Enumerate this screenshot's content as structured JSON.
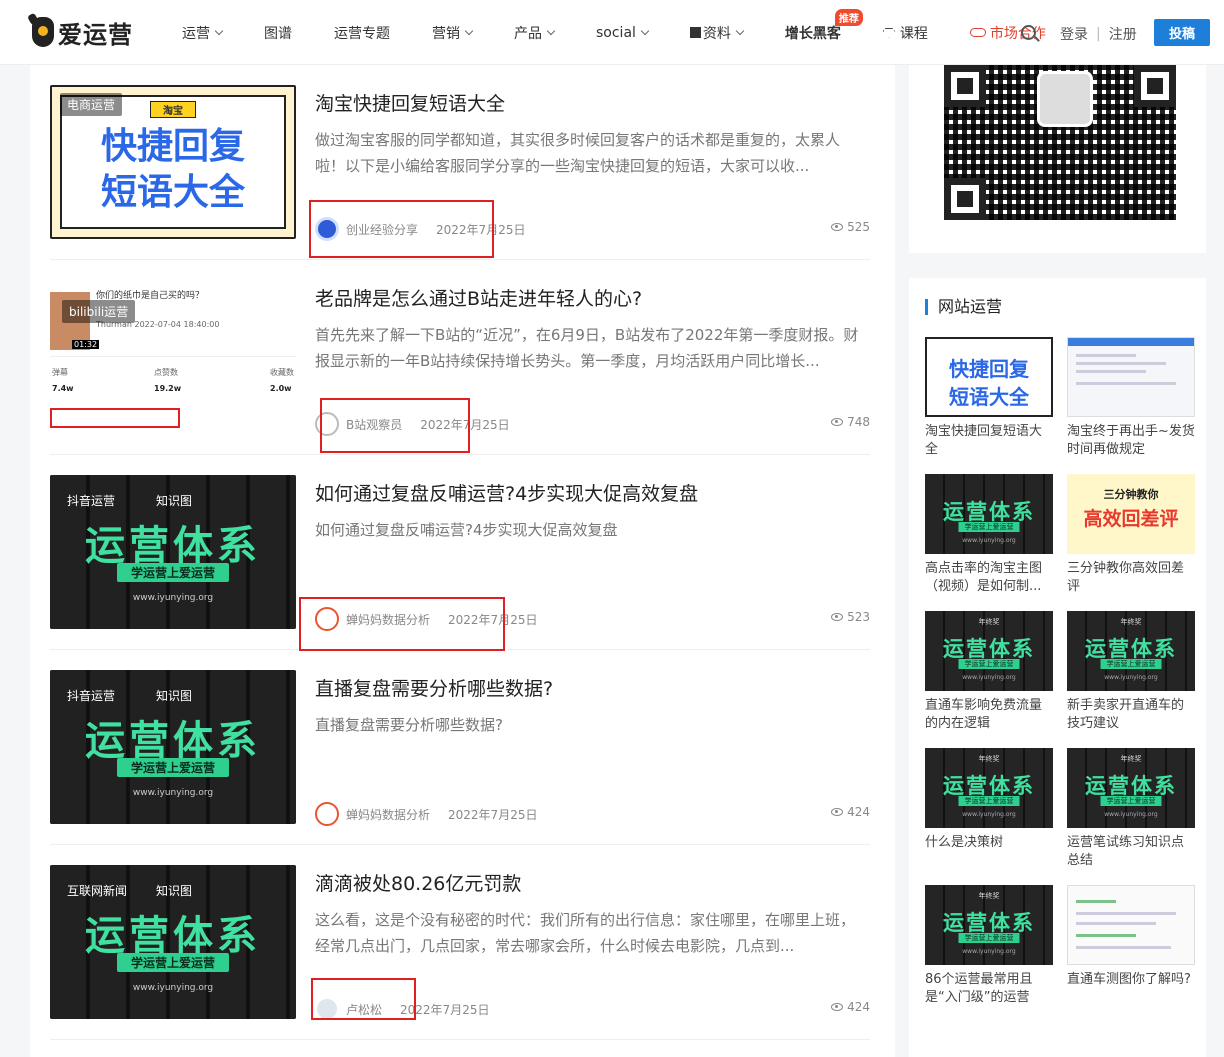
{
  "header": {
    "logo_text": "爱运营",
    "nav": [
      {
        "label": "运营",
        "dropdown": true
      },
      {
        "label": "图谱",
        "dropdown": false
      },
      {
        "label": "运营专题",
        "dropdown": false
      },
      {
        "label": "营销",
        "dropdown": true
      },
      {
        "label": "产品",
        "dropdown": true
      },
      {
        "label": "social",
        "dropdown": true
      },
      {
        "label": "资料",
        "dropdown": true
      },
      {
        "label": "增长黑客",
        "badge": "推荐"
      },
      {
        "label": "课程"
      },
      {
        "label": "市场合作"
      }
    ],
    "login": "登录",
    "register": "注册",
    "post_button": "投稿"
  },
  "articles": [
    {
      "title": "淘宝快捷回复短语大全",
      "excerpt": "做过淘宝客服的同学都知道，其实很多时候回复客户的话术都是重复的，太累人啦！以下是小编给客服同学分享的一些淘宝快捷回复的短语，大家可以收...",
      "author": "创业经验分享",
      "date": "2022年7月25日",
      "views": "525",
      "tag": "电商运营",
      "thumb_pill": "淘宝",
      "thumb_line1": "快捷回复",
      "thumb_line2": "短语大全"
    },
    {
      "title": "老品牌是怎么通过B站走进年轻人的心?",
      "excerpt": "首先先来了解一下B站的“近况”，在6月9日，B站发布了2022年第一季度财报。财报显示新的一年B站持续保持增长势头。第一季度，月均活跃用户同比增长...",
      "author": "B站观察员",
      "date": "2022年7月25日",
      "views": "748",
      "tag": "bilibili运营",
      "thumb_texts": [
        "你们的纸巾是自己买的吗？",
        "Thurman 2022-07-04 18:40:00",
        "01:32",
        "弹幕",
        "点赞数",
        "收藏数",
        "7.4w",
        "19.2w",
        "2.0w"
      ]
    },
    {
      "title": "如何通过复盘反哺运营?4步实现大促高效复盘",
      "excerpt": "如何通过复盘反哺运营?4步实现大促高效复盘",
      "author": "蝉妈妈数据分析",
      "date": "2022年7月25日",
      "views": "523",
      "tag": "抖音运营",
      "tag2": "知识图"
    },
    {
      "title": "直播复盘需要分析哪些数据?",
      "excerpt": "直播复盘需要分析哪些数据?",
      "author": "蝉妈妈数据分析",
      "date": "2022年7月25日",
      "views": "424",
      "tag": "抖音运营",
      "tag2": "知识图"
    },
    {
      "title": "滴滴被处80.26亿元罚款",
      "excerpt": "这么看，这是个没有秘密的时代：我们所有的出行信息：家住哪里，在哪里上班，经常几点出门，几点回家，常去哪家会所，什么时候去电影院，几点到...",
      "author": "卢松松",
      "date": "2022年7月25日",
      "views": "424",
      "tag": "互联网新闻",
      "tag2": "知识图"
    }
  ],
  "thumb_brand": {
    "big": "运营体系",
    "sub": "学运营上爱运营",
    "url": "www.iyunying.org",
    "top": "年终奖"
  },
  "sidebar": {
    "title": "网站运营",
    "items": [
      {
        "title": "淘宝快捷回复短语大全"
      },
      {
        "title": "淘宝终于再出手~发货时间再做规定"
      },
      {
        "title": "高点击率的淘宝主图（视频）是如何制..."
      },
      {
        "title": "三分钟教你高效回差评",
        "img_a": "三分钟教你",
        "img_b": "高效回差评"
      },
      {
        "title": "直通车影响免费流量的内在逻辑"
      },
      {
        "title": "新手卖家开直通车的技巧建议"
      },
      {
        "title": "什么是决策树"
      },
      {
        "title": "运营笔试练习知识点总结"
      },
      {
        "title": "86个运营最常用且是“入门级”的运营专..."
      },
      {
        "title": "直通车测图你了解吗?"
      }
    ]
  },
  "colors": {
    "accent": "#1e7fdb",
    "highlight": "#e02020",
    "badge": "#f24a2e"
  }
}
